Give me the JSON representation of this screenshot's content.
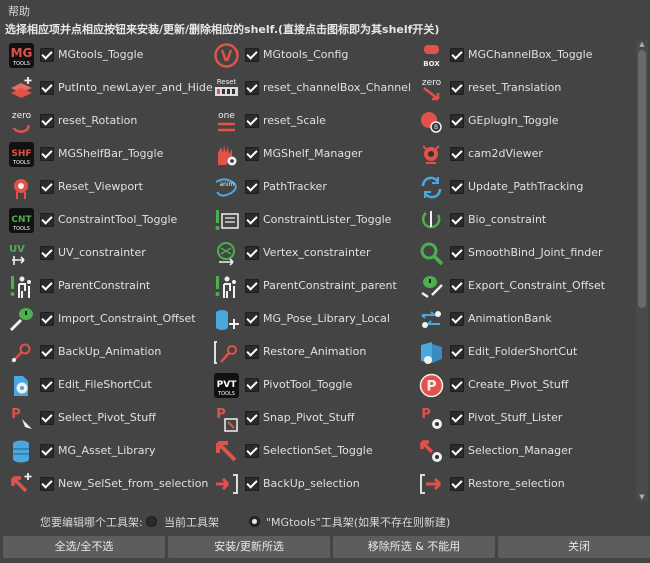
{
  "menu": {
    "help": "帮助"
  },
  "instruction": "选择相应项并点相应按钮来安装/更新/删除相应的shelf.(直接点击图标即为其shelf开关)",
  "items": [
    {
      "label": "MGtools_Toggle",
      "icon": "mg-tools-icon",
      "checked": true
    },
    {
      "label": "MGtools_Config",
      "icon": "wrench-config-icon",
      "checked": true
    },
    {
      "label": "MGChannelBox_Toggle",
      "icon": "channelbox-icon",
      "checked": true
    },
    {
      "label": "PutInto_newLayer_and_Hide",
      "icon": "layer-add-icon",
      "checked": true
    },
    {
      "label": "reset_channelBox_Channel",
      "icon": "reset-channel-icon",
      "checked": true
    },
    {
      "label": "reset_Translation",
      "icon": "zero-translate-icon",
      "checked": true
    },
    {
      "label": "reset_Rotation",
      "icon": "zero-rotate-icon",
      "checked": true
    },
    {
      "label": "reset_Scale",
      "icon": "one-scale-icon",
      "checked": true
    },
    {
      "label": "GEplugIn_Toggle",
      "icon": "geplugin-icon",
      "checked": true
    },
    {
      "label": "MGShelfBar_Toggle",
      "icon": "shf-tools-icon",
      "checked": true
    },
    {
      "label": "MGShelf_Manager",
      "icon": "hand-gear-icon",
      "checked": true
    },
    {
      "label": "cam2dViewer",
      "icon": "camera-2d-icon",
      "checked": true
    },
    {
      "label": "Reset_Viewport",
      "icon": "viewport-reset-icon",
      "checked": true
    },
    {
      "label": "PathTracker",
      "icon": "path-tracker-icon",
      "checked": true
    },
    {
      "label": "Update_PathTracking",
      "icon": "update-path-icon",
      "checked": true
    },
    {
      "label": "ConstraintTool_Toggle",
      "icon": "cnt-tools-icon",
      "checked": true
    },
    {
      "label": "ConstraintLister_Toggle",
      "icon": "constraint-lister-icon",
      "checked": true
    },
    {
      "label": "Bio_constraint",
      "icon": "bio-constraint-icon",
      "checked": true
    },
    {
      "label": "UV_constrainter",
      "icon": "uv-constraint-icon",
      "checked": true
    },
    {
      "label": "Vertex_constrainter",
      "icon": "vertex-constraint-icon",
      "checked": true
    },
    {
      "label": "SmoothBind_Joint_finder",
      "icon": "magnifier-icon",
      "checked": true
    },
    {
      "label": "ParentConstraint",
      "icon": "parent-constraint-icon",
      "checked": true
    },
    {
      "label": "ParentConstraint_parent",
      "icon": "parent-constraint-parent-icon",
      "checked": true
    },
    {
      "label": "Export_Constraint_Offset",
      "icon": "export-constraint-icon",
      "checked": true
    },
    {
      "label": "Import_Constraint_Offset",
      "icon": "import-constraint-icon",
      "checked": true
    },
    {
      "label": "MG_Pose_Library_Local",
      "icon": "pose-library-icon",
      "checked": true
    },
    {
      "label": "AnimationBank",
      "icon": "animation-bank-icon",
      "checked": true
    },
    {
      "label": "BackUp_Animation",
      "icon": "backup-animation-icon",
      "checked": true
    },
    {
      "label": "Restore_Animation",
      "icon": "restore-animation-icon",
      "checked": true
    },
    {
      "label": "Edit_FolderShortCut",
      "icon": "folder-shortcut-icon",
      "checked": true
    },
    {
      "label": "Edit_FileShortCut",
      "icon": "file-shortcut-icon",
      "checked": true
    },
    {
      "label": "PivotTool_Toggle",
      "icon": "pvt-tools-icon",
      "checked": true
    },
    {
      "label": "Create_Pivot_Stuff",
      "icon": "pivot-p-icon",
      "checked": true
    },
    {
      "label": "Select_Pivot_Stuff",
      "icon": "select-pivot-icon",
      "checked": true
    },
    {
      "label": "Snap_Pivot_Stuff",
      "icon": "snap-pivot-icon",
      "checked": true
    },
    {
      "label": "Pivot_Stuff_Lister",
      "icon": "pivot-lister-icon",
      "checked": true
    },
    {
      "label": "MG_Asset_Library",
      "icon": "asset-library-icon",
      "checked": true
    },
    {
      "label": "SelectionSet_Toggle",
      "icon": "selection-set-icon",
      "checked": true
    },
    {
      "label": "Selection_Manager",
      "icon": "selection-manager-icon",
      "checked": true
    },
    {
      "label": "New_SelSet_from_selection",
      "icon": "new-selset-icon",
      "checked": true
    },
    {
      "label": "BackUp_selection",
      "icon": "backup-selection-icon",
      "checked": true
    },
    {
      "label": "Restore_selection",
      "icon": "restore-selection-icon",
      "checked": true
    }
  ],
  "options": {
    "question": "您要编辑哪个工具架:",
    "current_shelf": "当前工具架",
    "mgtools_shelf": "\"MGtools\"工具架(如果不存在则新建)",
    "selected": "mgtools_shelf"
  },
  "buttons": {
    "select_all": "全选/全不选",
    "install": "安装/更新所选",
    "remove": "移除所选 & 不能用",
    "close": "关闭"
  },
  "colors": {
    "background": "#444444",
    "button": "#5d5d5d",
    "accent": "#e0524a"
  }
}
